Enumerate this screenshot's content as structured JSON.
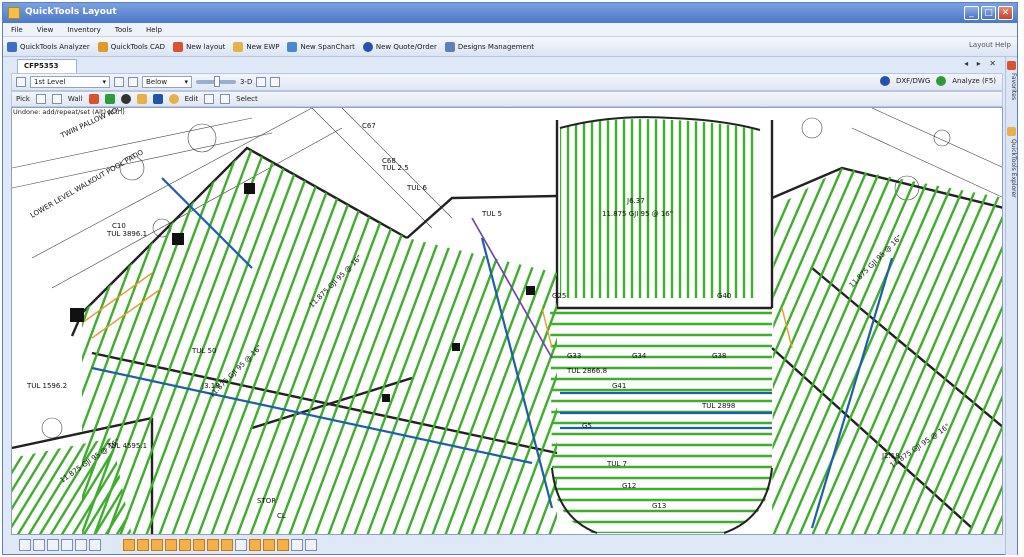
{
  "app": {
    "title": "QuickTools Layout",
    "window_buttons": [
      "_",
      "□",
      "✕"
    ]
  },
  "menu": [
    "File",
    "View",
    "Inventory",
    "Tools",
    "Help"
  ],
  "toolbar": {
    "items": [
      "QuickTools Analyzer",
      "QuickTools CAD",
      "New layout",
      "New EWP",
      "New SpanChart",
      "New Quote/Order",
      "Designs Management"
    ],
    "right_items": [
      "Layout Help"
    ]
  },
  "doc_tabs": [
    "CFP5353"
  ],
  "tab_arrows": "◂ ▸ ✕",
  "layout_toolbar": {
    "level_select": "1st Level",
    "view_select": "Below",
    "mode_3d": "3-D",
    "right": [
      "DXF/DWG",
      "Analyze (F5)"
    ]
  },
  "tools_toolbar": {
    "pick": "Pick",
    "wall": "Wall",
    "edit": "Edit",
    "select": "Select"
  },
  "status_hint": "Undone: add/repeat/set (Alt) (Ctrl)",
  "side_panel": {
    "tabs": [
      "Favorites",
      "QuickTools Explorer"
    ]
  },
  "drawing": {
    "labels": [
      "TWIN PALLOW ROOM LEVEL PATIO",
      "LOWER LEVEL WALKOUT POOL PATIO",
      "C67",
      "C68",
      "TUL 2.5",
      "TUL 6",
      "C10",
      "TUL 3896.1",
      "TUL 50",
      "TUL 1596.2",
      "TUL 4595.1",
      "TUL 2898",
      "TUL 2866.8",
      "TUL 5",
      "TUL 7",
      "11.875 GJI 95 @ 16\"",
      "11.875 GJI 95 @ 16\"",
      "11.875 GJI 95 @ 16\"",
      "11.875 GJI 95 @ 16\"",
      "11.875 GJI 95 @ 16\"",
      "11.875 GJI 95 @ 16\"",
      "J6.37",
      "J3.18",
      "J2.18",
      "STOR",
      "CL",
      "G25",
      "G33",
      "G34",
      "G38",
      "G40",
      "G41",
      "G12",
      "G5",
      "G13"
    ]
  }
}
